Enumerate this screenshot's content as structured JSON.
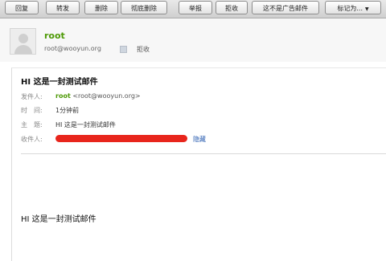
{
  "toolbar": {
    "reply": "回复",
    "forward": "转发",
    "delete": "删除",
    "delete_forever": "彻底删除",
    "report": "举报",
    "reject": "拒收",
    "not_spam": "这不是广告邮件",
    "mark_as": "标记为..."
  },
  "sender": {
    "name": "root",
    "email": "root@wooyun.org",
    "reject_label": "拒收"
  },
  "message": {
    "subject": "HI 这是一封测试邮件",
    "from_label": "发件人:",
    "from_name": "root",
    "from_addr": "<root@wooyun.org>",
    "time_label": "时　间:",
    "time_value": "1分钟前",
    "subject_label": "主　题:",
    "subject_value": "HI 这是一封测试邮件",
    "to_label": "收件人:",
    "hide_label": "隐藏",
    "body": "HI 这是一封测试邮件"
  },
  "colors": {
    "sender_green": "#4e9a06",
    "link_blue": "#2a5db0",
    "redaction_red": "#e8251c"
  }
}
